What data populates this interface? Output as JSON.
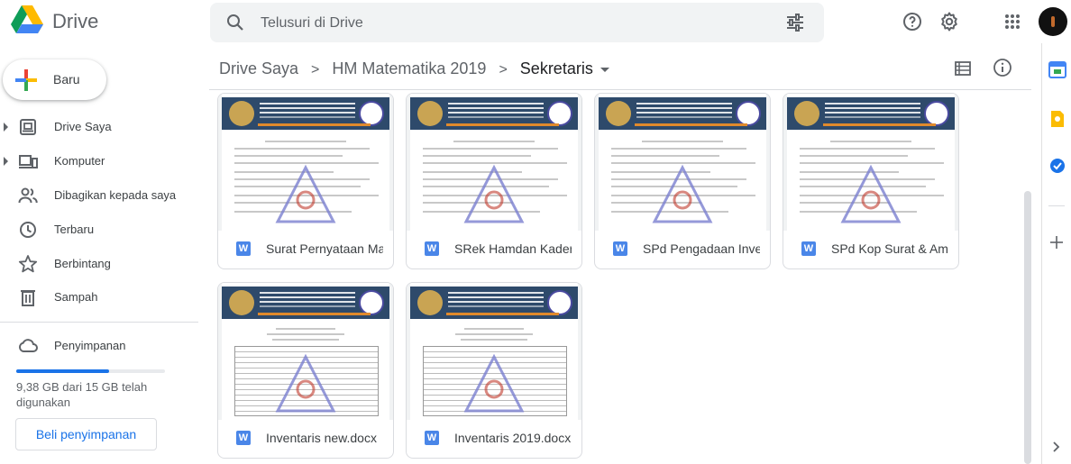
{
  "header": {
    "app_name": "Drive",
    "search_placeholder": "Telusuri di Drive"
  },
  "sidebar": {
    "new_button": "Baru",
    "items": [
      {
        "label": "Drive Saya",
        "icon": "my-drive-icon"
      },
      {
        "label": "Komputer",
        "icon": "computer-icon"
      },
      {
        "label": "Dibagikan kepada saya",
        "icon": "shared-icon"
      },
      {
        "label": "Terbaru",
        "icon": "clock-icon"
      },
      {
        "label": "Berbintang",
        "icon": "star-icon"
      },
      {
        "label": "Sampah",
        "icon": "trash-icon"
      }
    ],
    "storage": {
      "label": "Penyimpanan",
      "usage_text": "9,38 GB dari 15 GB telah digunakan",
      "used_fraction": 0.625,
      "buy_button": "Beli penyimpanan"
    }
  },
  "breadcrumb": {
    "items": [
      "Drive Saya",
      "HM Matematika 2019",
      "Sekretaris"
    ],
    "separator": ">"
  },
  "files": [
    {
      "name": "Surat Pernyataan Mas...",
      "type_icon": "W",
      "thumb": "letter"
    },
    {
      "name": "SRek Hamdan Kader ...",
      "type_icon": "W",
      "thumb": "letter"
    },
    {
      "name": "SPd Pengadaan Inven...",
      "type_icon": "W",
      "thumb": "letter"
    },
    {
      "name": "SPd Kop Surat & Ampl...",
      "type_icon": "W",
      "thumb": "letter"
    },
    {
      "name": "Inventaris new.docx",
      "type_icon": "W",
      "thumb": "table"
    },
    {
      "name": "Inventaris 2019.docx",
      "type_icon": "W",
      "thumb": "table"
    }
  ],
  "colors": {
    "accent": "#1a73e8",
    "word_icon": "#4a86e8",
    "banner": "#2e4a6b"
  }
}
